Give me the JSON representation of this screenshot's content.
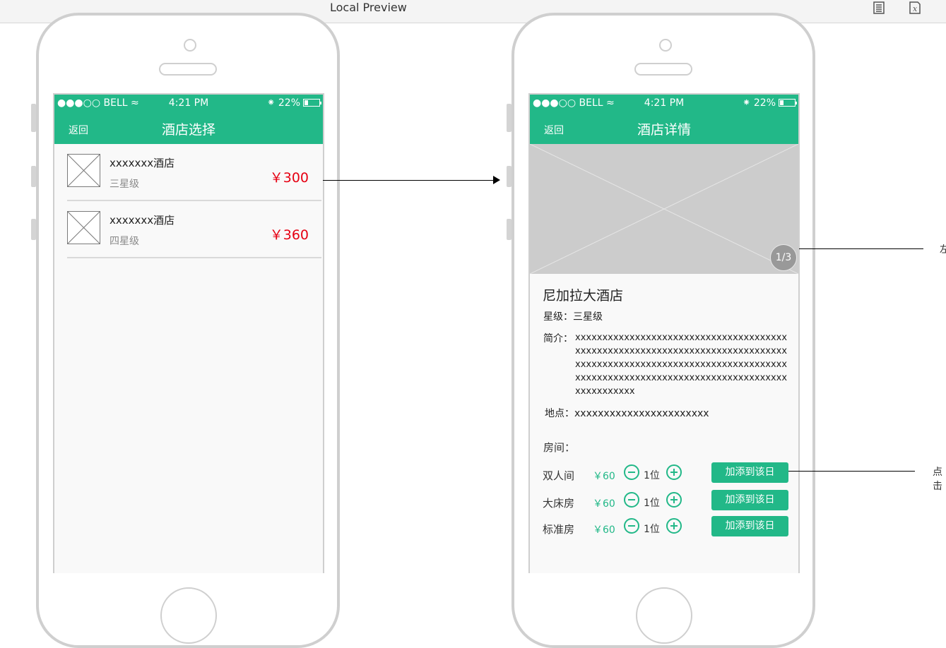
{
  "preview": {
    "title": "Local Preview",
    "icons": [
      "document-icon",
      "formula-icon"
    ]
  },
  "status": {
    "carrier": "●●●○○ BELL",
    "time": "4:21 PM",
    "battery": "22%"
  },
  "colors": {
    "primary": "#22b888",
    "price": "#e60012"
  },
  "list_screen": {
    "back_label": "返回",
    "title": "酒店选择",
    "hotels": [
      {
        "name": "xxxxxxx酒店",
        "star": "三星级",
        "price": "￥300"
      },
      {
        "name": "xxxxxxx酒店",
        "star": "四星级",
        "price": "￥360"
      }
    ]
  },
  "detail_screen": {
    "back_label": "返回",
    "title": "酒店详情",
    "pager": "1/3",
    "hotel_name": "尼加拉大酒店",
    "star_line": "星级：三星级",
    "intro_label": "简介：",
    "intro_text": "xxxxxxxxxxxxxxxxxxxxxxxxxxxxxxxxxxxxxxxxxxxxxxxxxxxxxxxxxxxxxxxxxxxxxxxxxxxxxxxxxxxxxxxxxxxxxxxxxxxxxxxxxxxxxxxxxxxxxxxxxxxxxxxxxxxxxxxxxxxxxxxxxxxxxxxxxxxxxxxxxxxxxxx",
    "location_line": "地点：xxxxxxxxxxxxxxxxxxxxxxx",
    "rooms_label": "房间：",
    "rooms": [
      {
        "name": "双人间",
        "price": "￥60",
        "count": "1位",
        "button": "加添到该日"
      },
      {
        "name": "大床房",
        "price": "￥60",
        "count": "1位",
        "button": "加添到该日"
      },
      {
        "name": "标准房",
        "price": "￥60",
        "count": "1位",
        "button": "加添到该日"
      }
    ]
  },
  "side_notes": {
    "gallery_note": "左",
    "button_note": "点击"
  }
}
